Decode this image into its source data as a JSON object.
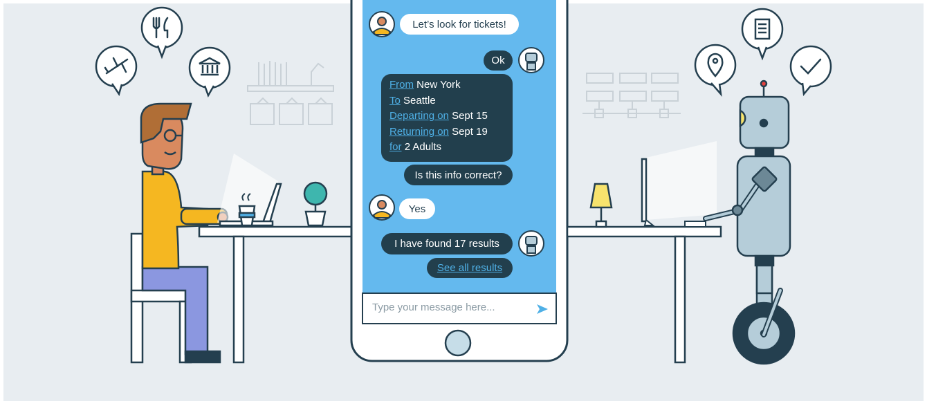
{
  "chat": {
    "messages": [
      {
        "sender": "user",
        "text": "Let’s look for tickets!"
      },
      {
        "sender": "bot",
        "text": "Ok"
      },
      {
        "sender": "bot",
        "type": "card",
        "lines": [
          {
            "label": "From",
            "value": "New York"
          },
          {
            "label": "To",
            "value": "Seattle"
          },
          {
            "label": "Departing on",
            "value": "Sept 15"
          },
          {
            "label": "Returning on",
            "value": "Sept 19"
          },
          {
            "label": "for",
            "value": "2 Adults"
          }
        ]
      },
      {
        "sender": "bot",
        "text": "Is this info correct?"
      },
      {
        "sender": "user",
        "text": "Yes"
      },
      {
        "sender": "bot",
        "text": "I have found 17 results"
      },
      {
        "sender": "bot",
        "link": "See all results"
      }
    ],
    "input": {
      "placeholder": "Type your message here..."
    }
  },
  "colors": {
    "background": "#e8edf1",
    "chat_background": "#64b9ee",
    "bot_bubble": "#223f4d",
    "user_bubble": "#ffffff",
    "link": "#4fb0e6",
    "line": "#243f4f"
  },
  "icons": [
    "plane-icon",
    "fork-knife-icon",
    "museum-icon",
    "location-pin-icon",
    "document-icon",
    "checkmark-icon",
    "send-icon",
    "user-avatar-icon",
    "bot-avatar-icon"
  ]
}
